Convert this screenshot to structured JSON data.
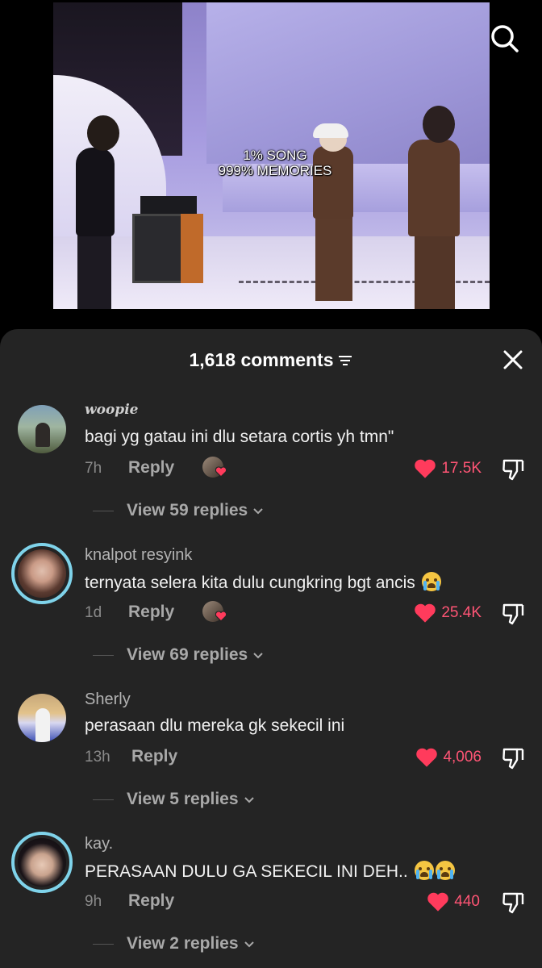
{
  "video": {
    "overlay_line1": "1% SONG",
    "overlay_line2": "999% MEMORIES"
  },
  "header": {
    "comments_count": "1,618 comments"
  },
  "comments": [
    {
      "username": "woopie",
      "text": "bagi yg gatau ini dlu setara cortis yh tmn\"",
      "time": "7h",
      "reply_label": "Reply",
      "likes": "17.5K",
      "view_replies": "View 59 replies",
      "creator_liked": true,
      "ring": false
    },
    {
      "username": "knalpot resyink",
      "text": "ternyata selera kita dulu cungkring bgt ancis",
      "emojis": 1,
      "time": "1d",
      "reply_label": "Reply",
      "likes": "25.4K",
      "view_replies": "View 69 replies",
      "creator_liked": true,
      "ring": true
    },
    {
      "username": "Sherly",
      "text": "perasaan dlu mereka gk sekecil ini",
      "time": "13h",
      "reply_label": "Reply",
      "likes": "4,006",
      "view_replies": "View 5 replies",
      "creator_liked": false,
      "ring": false
    },
    {
      "username": "kay.",
      "text": "PERASAAN DULU GA SEKECIL INI DEH..",
      "emojis": 2,
      "time": "9h",
      "reply_label": "Reply",
      "likes": "440",
      "view_replies": "View 2 replies",
      "creator_liked": false,
      "ring": true
    }
  ],
  "colors": {
    "sheet_bg": "#242424",
    "like_red": "#ff3b5c",
    "ring_blue": "#7fd3ea"
  },
  "icons": {
    "search": "search-icon",
    "close": "close-icon",
    "sort": "sort-icon",
    "heart": "heart-icon",
    "dislike": "thumbs-down-icon",
    "chevron": "chevron-down-icon"
  }
}
